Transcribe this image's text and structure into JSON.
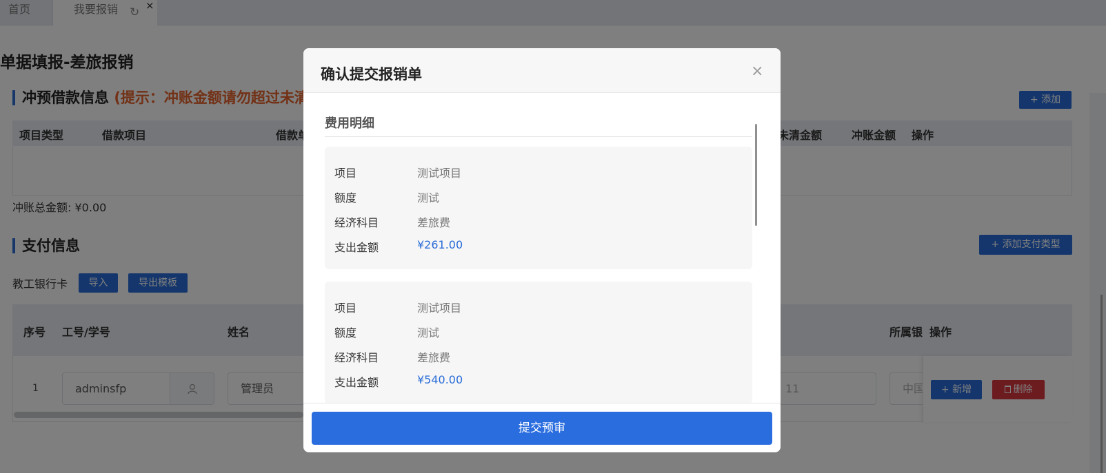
{
  "tabs": {
    "home": "首页",
    "active": "我要报销",
    "refresh_icon": "↻",
    "close_icon": "×"
  },
  "page": {
    "title": "单据填报-差旅报销"
  },
  "offset_section": {
    "title": "冲预借款信息",
    "hint": "(提示：冲账金额请勿超过未清",
    "add_button": "+ 添加",
    "columns": [
      "项目类型",
      "借款项目",
      "借款单",
      "未清金额",
      "冲账金额",
      "操作"
    ],
    "total_label": "冲账总金额:",
    "total_value": "¥0.00"
  },
  "payment_section": {
    "title": "支付信息",
    "add_type_button": "+ 添加支付类型",
    "bank_card_label": "教工银行卡",
    "import_button": "导入",
    "export_button": "导出模板",
    "columns": [
      "序号",
      "工号/学号",
      "姓名",
      "所属银",
      "操作"
    ],
    "row": {
      "index": "1",
      "staff_id": "adminsfp",
      "name": "管理员",
      "account_tail": "11",
      "bank": "中国",
      "add_button": "+ 新增",
      "delete_button": "删除"
    }
  },
  "modal": {
    "title": "确认提交报销单",
    "close_icon": "×",
    "section_title": "费用明细",
    "labels": {
      "project": "项目",
      "quota": "额度",
      "subject": "经济科目",
      "amount": "支出金额"
    },
    "items": [
      {
        "project": "测试项目",
        "quota": "测试",
        "subject": "差旅费",
        "amount": "¥261.00"
      },
      {
        "project": "测试项目",
        "quota": "测试",
        "subject": "差旅费",
        "amount": "¥540.00"
      }
    ],
    "submit_button": "提交预审"
  },
  "colors": {
    "accent": "#2a6dd8",
    "hint": "#e4632c",
    "danger": "#d9363e"
  }
}
